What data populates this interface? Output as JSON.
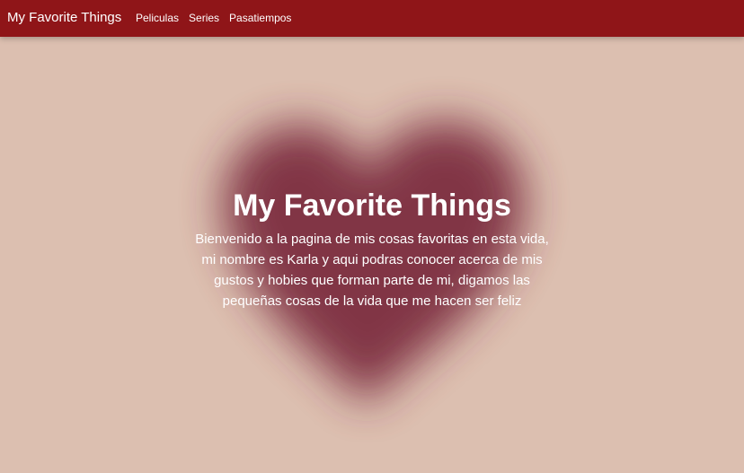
{
  "navbar": {
    "brand": "My Favorite Things",
    "links": [
      "Peliculas",
      "Series",
      "Pasatiempos"
    ]
  },
  "hero": {
    "title": "My Favorite Things",
    "text": "Bienvenido a la pagina de mis cosas favoritas en esta vida, mi nombre es Karla y aqui podras conocer acerca de mis gustos y hobies que forman parte de mi, digamos las pequeñas cosas de la vida que me hacen ser feliz"
  },
  "colors": {
    "navbar": "#8f1518",
    "background": "#dcbfb0",
    "heart": "#7a2a3c",
    "text": "#ffffff"
  },
  "icons": {
    "background_image": "blurred-heart"
  }
}
